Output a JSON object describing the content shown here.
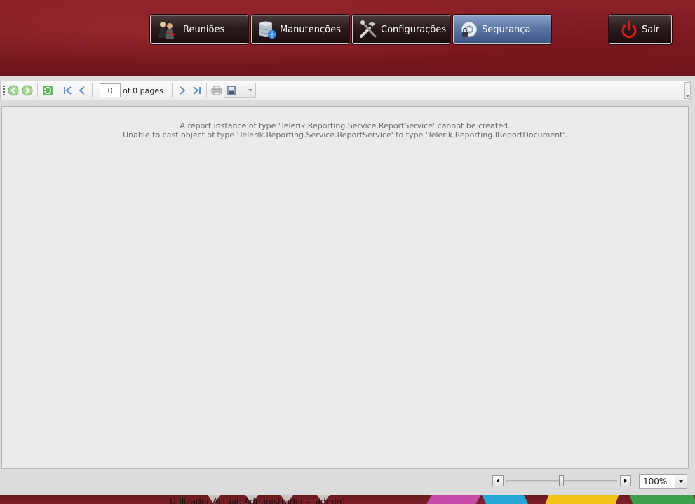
{
  "nav": {
    "items": [
      {
        "label": "Reuniões",
        "icon": "meeting-people-icon",
        "active": false
      },
      {
        "label": "Manutenções",
        "icon": "database-icon",
        "active": false
      },
      {
        "label": "Configurações",
        "icon": "tools-icon",
        "active": false
      },
      {
        "label": "Segurança",
        "icon": "security-disc-icon",
        "active": true
      }
    ],
    "logout_label": "Sair",
    "logout_icon": "power-icon"
  },
  "toolbar": {
    "current_page": "0",
    "page_of_text": "of 0 pages",
    "buttons": [
      "back-icon",
      "forward-icon",
      "refresh-icon",
      "first-page-icon",
      "previous-page-icon",
      "next-page-icon",
      "last-page-icon",
      "print-icon",
      "export-icon"
    ]
  },
  "report": {
    "error_line1": "A report instance of type 'Telerik.Reporting.Service.ReportService' cannot be created.",
    "error_line2": "Unable to cast object of type 'Telerik.Reporting.Service.ReportService' to type 'Telerik.Reporting.IReportDocument'."
  },
  "zoom": {
    "value": "100%"
  },
  "footer": {
    "user_text": "Utilizador Actual: Administrador - [admin]"
  },
  "colors": {
    "header_red": "#7a1c22",
    "active_tab_blue": "#5c77a6",
    "viewer_bg": "#dcdcdc",
    "error_text": "#6b6b6b"
  }
}
